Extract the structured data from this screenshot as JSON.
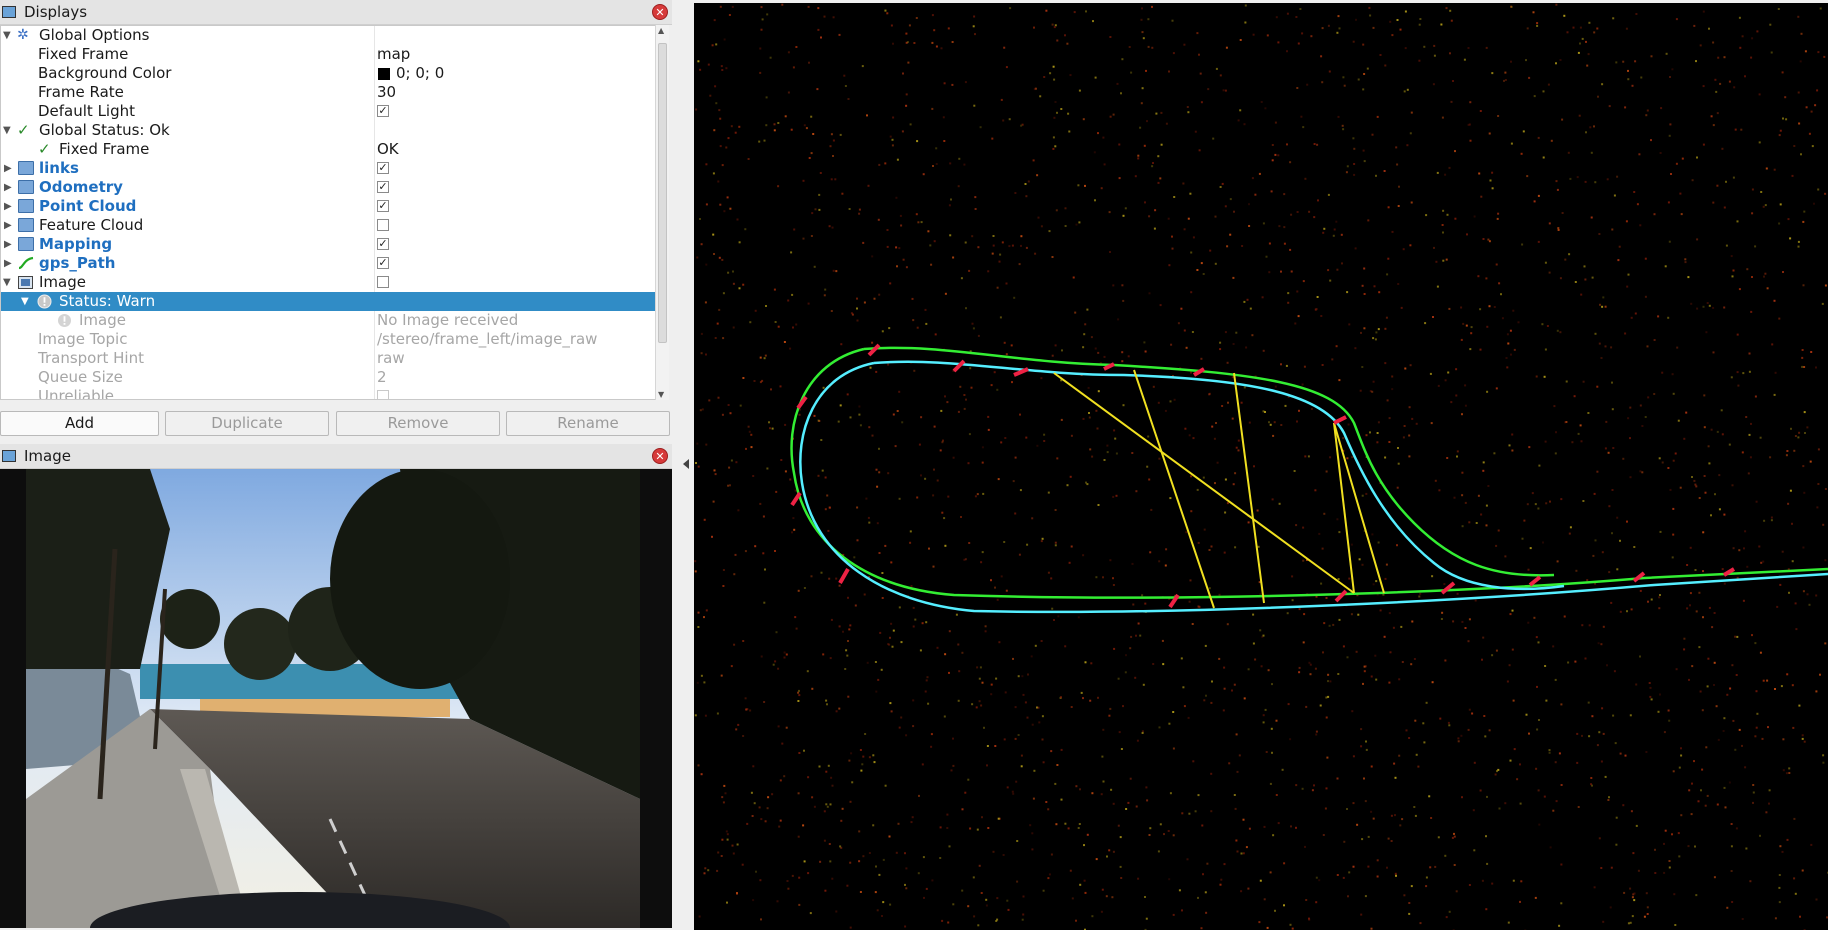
{
  "displays_panel": {
    "title": "Displays",
    "rows": [
      {
        "label": "Global Options"
      },
      {
        "label": "Fixed Frame",
        "value": "map"
      },
      {
        "label": "Background Color",
        "value": "0; 0; 0"
      },
      {
        "label": "Frame Rate",
        "value": "30"
      },
      {
        "label": "Default Light",
        "checked": true
      },
      {
        "label": "Global Status: Ok"
      },
      {
        "label": "Fixed Frame",
        "value": "OK"
      },
      {
        "label": "links",
        "checked": true
      },
      {
        "label": "Odometry",
        "checked": true
      },
      {
        "label": "Point Cloud",
        "checked": true
      },
      {
        "label": "Feature Cloud",
        "checked": false
      },
      {
        "label": "Mapping",
        "checked": true
      },
      {
        "label": "gps_Path",
        "checked": true
      },
      {
        "label": "Image",
        "checked": false
      },
      {
        "label": "Status: Warn"
      },
      {
        "label": "Image",
        "value": "No Image received"
      },
      {
        "label": "Image Topic",
        "value": "/stereo/frame_left/image_raw"
      },
      {
        "label": "Transport Hint",
        "value": "raw"
      },
      {
        "label": "Queue Size",
        "value": "2"
      },
      {
        "label": "Unreliable",
        "checked": false
      }
    ],
    "buttons": {
      "add": "Add",
      "duplicate": "Duplicate",
      "remove": "Remove",
      "rename": "Rename"
    }
  },
  "image_panel": {
    "title": "Image"
  },
  "colors": {
    "selection": "#308cc6",
    "blue_label": "#1f6fc0",
    "trajectory_green": "#33ee33",
    "trajectory_cyan": "#55eeff",
    "loop_yellow": "#f0e020",
    "marker_red": "#ee2244",
    "background": "#000000"
  },
  "icons": [
    "monitor-icon",
    "close-icon",
    "gear-icon",
    "checkmark-icon",
    "folder-icon",
    "path-icon",
    "image-icon",
    "warning-icon"
  ]
}
